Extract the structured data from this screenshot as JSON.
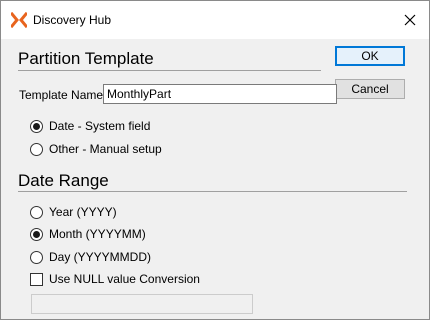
{
  "window": {
    "title": "Discovery Hub",
    "accent_color": "#e8641e"
  },
  "buttons": {
    "ok_label": "OK",
    "cancel_label": "Cancel"
  },
  "partition": {
    "heading": "Partition Template",
    "name_label": "Template Name",
    "name_value": "MonthlyPart",
    "options": [
      {
        "label": "Date - System field",
        "checked": true
      },
      {
        "label": "Other - Manual setup",
        "checked": false
      }
    ]
  },
  "date_range": {
    "heading": "Date Range",
    "options": [
      {
        "label": "Year (YYYY)",
        "checked": false
      },
      {
        "label": "Month (YYYYMM)",
        "checked": true
      },
      {
        "label": "Day (YYYYMMDD)",
        "checked": false
      }
    ],
    "null_conversion_label": "Use NULL value Conversion",
    "null_conversion_checked": false,
    "null_value": ""
  }
}
